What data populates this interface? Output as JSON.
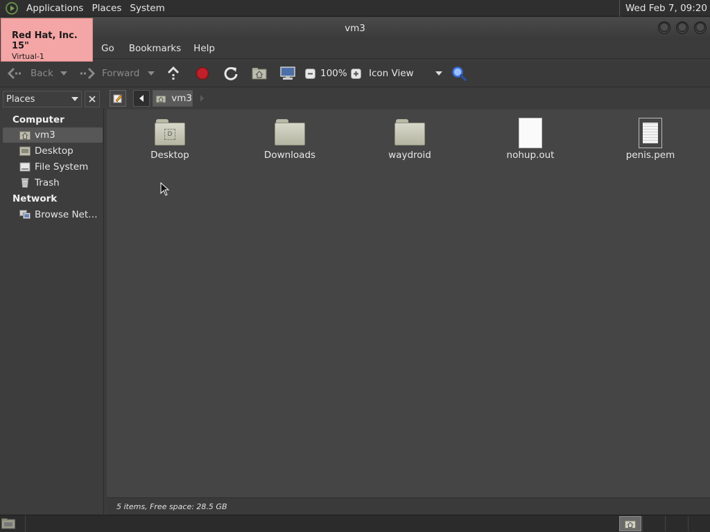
{
  "top_panel": {
    "menus": [
      "Applications",
      "Places",
      "System"
    ],
    "clock": "Wed Feb  7, 09:20"
  },
  "window": {
    "title": "vm3"
  },
  "tooltip": {
    "line1": "Red Hat, Inc. 15\"",
    "line2": "Virtual-1"
  },
  "menubar": {
    "items": [
      "Go",
      "Bookmarks",
      "Help"
    ]
  },
  "toolbar": {
    "back_label": "Back",
    "forward_label": "Forward",
    "zoom_level": "100%",
    "view_mode": "Icon View"
  },
  "location": {
    "current": "vm3"
  },
  "sidebar": {
    "header": "Places",
    "section_computer": "Computer",
    "section_network": "Network",
    "items": [
      {
        "label": "vm3",
        "icon": "home-folder-icon",
        "selected": true
      },
      {
        "label": "Desktop",
        "icon": "desktop-icon"
      },
      {
        "label": "File System",
        "icon": "drive-icon"
      },
      {
        "label": "Trash",
        "icon": "trash-icon"
      },
      {
        "label": "Browse Net…",
        "icon": "network-icon"
      }
    ]
  },
  "files": [
    {
      "name": "Desktop",
      "type": "folder",
      "icon": "desktop-folder-icon"
    },
    {
      "name": "Downloads",
      "type": "folder",
      "icon": "folder-icon"
    },
    {
      "name": "waydroid",
      "type": "folder",
      "icon": "folder-icon"
    },
    {
      "name": "nohup.out",
      "type": "file",
      "icon": "blank-file-icon"
    },
    {
      "name": "penis.pem",
      "type": "file",
      "icon": "text-file-icon"
    }
  ],
  "status": "5 items, Free space: 28.5 GB",
  "colors": {
    "tooltip_bg": "#f4a5a5",
    "stop_red": "#c0202a",
    "search_blue": "#3a6fd8"
  }
}
